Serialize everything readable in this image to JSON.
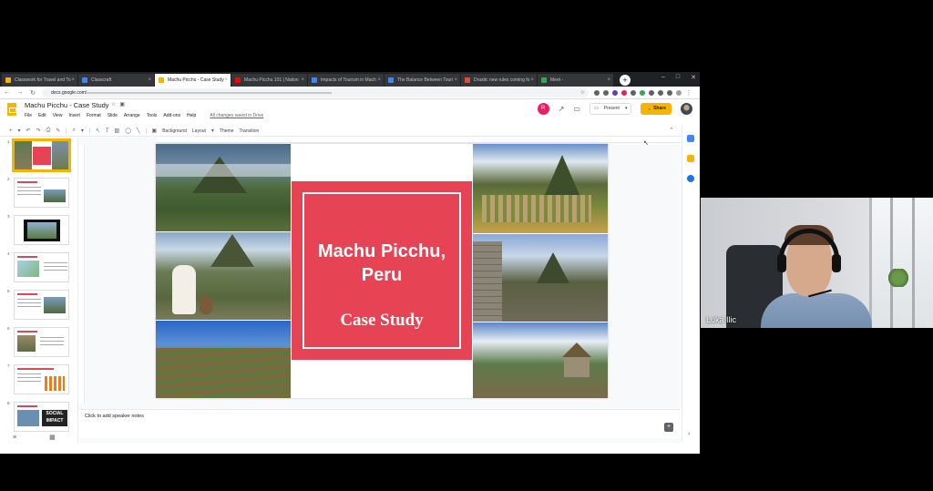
{
  "browser": {
    "tabs": [
      {
        "title": "Classwork for Travel and To",
        "color": "#f4b400",
        "active": false
      },
      {
        "title": "Classcraft",
        "color": "#4285f4",
        "active": false
      },
      {
        "title": "Machu Picchu - Case Study",
        "color": "#f4b400",
        "active": true
      },
      {
        "title": "Machu Picchu 101 | Nation",
        "color": "#ff0000",
        "active": false
      },
      {
        "title": "Impacts of Tourism in Mach",
        "color": "#4285f4",
        "active": false
      },
      {
        "title": "The Balance Between Touri",
        "color": "#4285f4",
        "active": false
      },
      {
        "title": "Drastic new rules coming fo",
        "color": "#e04b3a",
        "active": false
      },
      {
        "title": "Meet -",
        "color": "#34a853",
        "active": false
      }
    ],
    "url": "docs.google.com/",
    "new_tab": "+",
    "window_controls": [
      "–",
      "□",
      "✕"
    ]
  },
  "app": {
    "doc_title": "Machu Picchu - Case Study",
    "menu": [
      "File",
      "Edit",
      "View",
      "Insert",
      "Format",
      "Slide",
      "Arrange",
      "Tools",
      "Add-ons",
      "Help"
    ],
    "saved_status": "All changes saved in Drive",
    "user_initial": "R",
    "present_label": "Present",
    "share_label": "Share",
    "toolbar": {
      "background": "Background",
      "layout": "Layout",
      "theme": "Theme",
      "transition": "Transition"
    },
    "slide_numbers": [
      "1",
      "2",
      "3",
      "4",
      "5",
      "6",
      "7",
      "8"
    ],
    "thumb_impact_text": "SOCIAL IMPACT",
    "speaker_notes_placeholder": "Click to add speaker notes"
  },
  "slide": {
    "title": "Machu Picchu, Peru",
    "subtitle": "Case Study",
    "accent_color": "#e64355"
  },
  "webcam": {
    "name": "Luka Ilic"
  }
}
